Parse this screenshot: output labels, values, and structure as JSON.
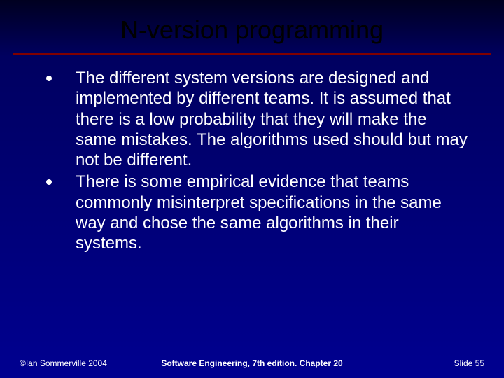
{
  "title": "N-version programming",
  "bullets": [
    "The different system versions are designed and implemented by different teams. It is assumed that there is a low probability that they will make the same mistakes. The algorithms used should but may not be different.",
    "There is some empirical evidence that teams commonly misinterpret specifications in the same way and chose the same algorithms in their systems."
  ],
  "footer": {
    "left": "©Ian Sommerville 2004",
    "center": "Software Engineering, 7th edition. Chapter 20",
    "right": "Slide 55"
  }
}
